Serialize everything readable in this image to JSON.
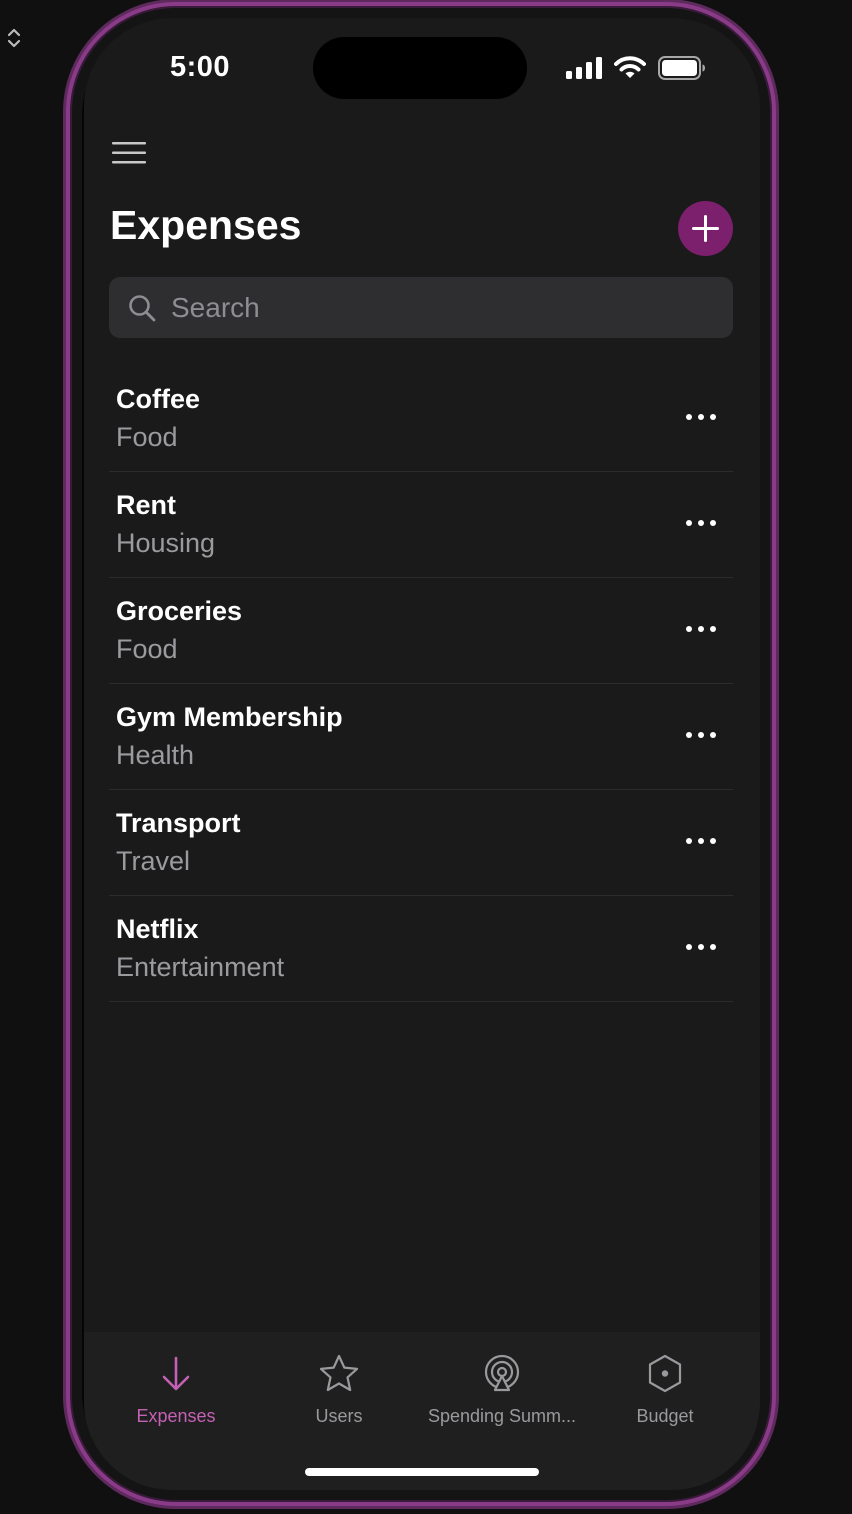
{
  "status_bar": {
    "time": "5:00"
  },
  "header": {
    "title": "Expenses",
    "menu_icon": "hamburger-menu-icon",
    "add_icon": "plus-icon"
  },
  "search": {
    "placeholder": "Search",
    "value": ""
  },
  "expenses": [
    {
      "title": "Coffee",
      "category": "Food"
    },
    {
      "title": "Rent",
      "category": "Housing"
    },
    {
      "title": "Groceries",
      "category": "Food"
    },
    {
      "title": "Gym Membership",
      "category": "Health"
    },
    {
      "title": "Transport",
      "category": "Travel"
    },
    {
      "title": "Netflix",
      "category": "Entertainment"
    }
  ],
  "tabs": [
    {
      "label": "Expenses",
      "icon": "arrow-down-icon",
      "active": true
    },
    {
      "label": "Users",
      "icon": "star-icon",
      "active": false
    },
    {
      "label": "Spending Summ...",
      "icon": "podcast-icon",
      "active": false
    },
    {
      "label": "Budget",
      "icon": "hexagon-icon",
      "active": false
    }
  ],
  "colors": {
    "accent": "#7c1f6c",
    "accent_tab": "#c561b4",
    "background": "#1a1a1a",
    "frame": "#8a3b88"
  }
}
